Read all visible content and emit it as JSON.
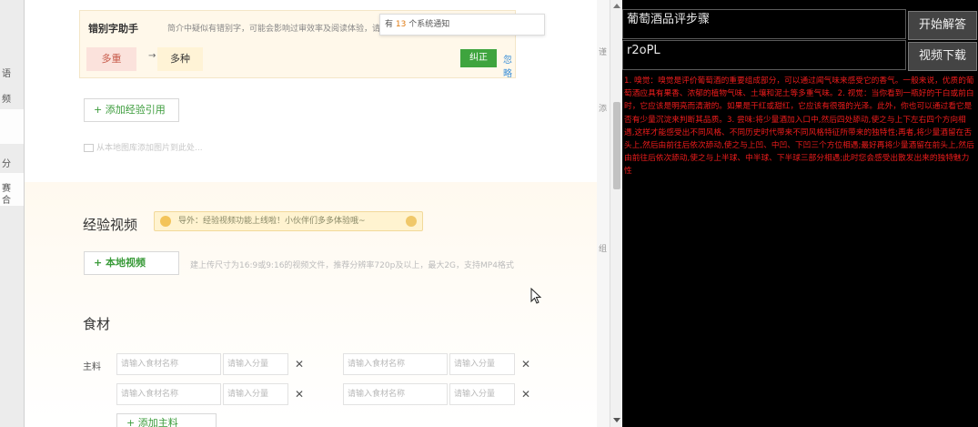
{
  "left_strip": {
    "chars": [
      "语",
      "频",
      "分",
      "赛",
      "合"
    ]
  },
  "typo_helper": {
    "title": "错别字助手",
    "description": "简介中疑似有错别字，可能会影响过审效率及阅读体验，请及时",
    "wrong": "多重",
    "arrow": "→",
    "correct": "多种",
    "fix_label": "纠正",
    "ignore_label": "忽略"
  },
  "notification": {
    "prefix": "有",
    "count": "13",
    "suffix": "个系统通知"
  },
  "add_reference_label": "+ 添加经验引用",
  "upload_hint": "从本地图库添加图片到此处...",
  "video_section": {
    "title": "经验视频",
    "tip": "导外：经验视频功能上线啦！小伙伴们多多体验哦~",
    "local_video_label": "+ 本地视频",
    "hint": "建上传尺寸为16:9或9:16的视频文件，推荐分辨率720p及以上，最大2G，支持MP4格式"
  },
  "ingredients": {
    "title": "食材",
    "main_label": "主料",
    "name_placeholder": "请输入食材名称",
    "amount_placeholder": "请输入分量",
    "remove_symbol": "✕",
    "add_main_label": "+ 添加主料"
  },
  "edge_chars": [
    "谨",
    "添",
    "组"
  ],
  "panel": {
    "query": "葡萄酒品评步骤",
    "start_label": "开始解答",
    "code": "r2oPL",
    "download_label": "视频下载",
    "answer": "1. 嗅觉：嗅觉是评价葡萄酒的重要组成部分，可以通过闻气味来感受它的香气。一般来说，优质的葡萄酒应具有果香、浓郁的植物气味、土壤和泥土等多重气味。2. 视觉：当你看到一瓶好的干白或前白时，它应该是明亮而清澈的。如果是干红或甜红，它应该有很强的光泽。此外，你也可以通过看它是否有少量沉淀来判断其品质。3. 尝味:将少量酒加入口中,然后四处舔动,使之与上下左右四个方向相遇,这样才能感受出不同风格、不同历史时代带来不同风格特征所带来的独特性;再者,将少量酒留在舌头上,然后由前往后依次舔动,使之与上凹、中凹、下凹三个方位相遇;最好再将少量酒留在前头上,然后由前往后依次舔动,使之与上半球、中半球、下半球三部分相遇;此时您会感受出散发出来的独特魅力性"
  }
}
